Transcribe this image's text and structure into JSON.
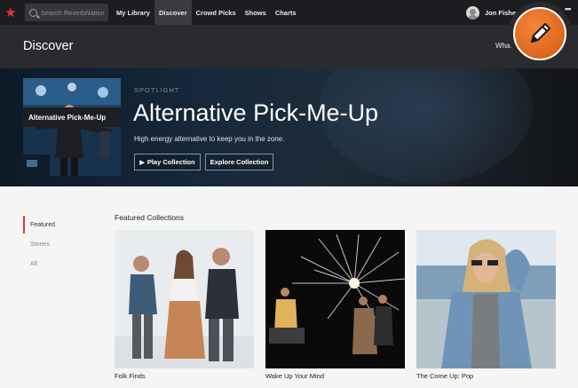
{
  "nav": {
    "search_placeholder": "Search ReverbNation",
    "links": [
      {
        "label": "My Library"
      },
      {
        "label": "Discover"
      },
      {
        "label": "Crowd Picks"
      },
      {
        "label": "Shows"
      },
      {
        "label": "Charts"
      }
    ],
    "user_name": "Jon Fisher",
    "more": "•••"
  },
  "header": {
    "title": "Discover",
    "menu_label": "What's Discover?"
  },
  "hero": {
    "eyebrow": "SPOTLIGHT",
    "title": "Alternative Pick-Me-Up",
    "description": "High energy alternative to keep you in the zone.",
    "thumb_caption": "Alternative Pick-Me-Up",
    "play_label": "Play Collection",
    "explore_label": "Explore Collection"
  },
  "sidebar": {
    "items": [
      {
        "label": "Featured",
        "active": true
      },
      {
        "label": "Stories",
        "active": false
      },
      {
        "label": "All",
        "active": false
      }
    ]
  },
  "featured": {
    "title": "Featured Collections",
    "cards": [
      {
        "label": "Folk Finds"
      },
      {
        "label": "Wake Up Your Mind"
      },
      {
        "label": "The Come Up: Pop"
      }
    ]
  },
  "colors": {
    "accent": "#e2353c",
    "nav_bg": "#1c1d20",
    "header_bg": "#2a2b2f",
    "badge": "#e8721f"
  }
}
